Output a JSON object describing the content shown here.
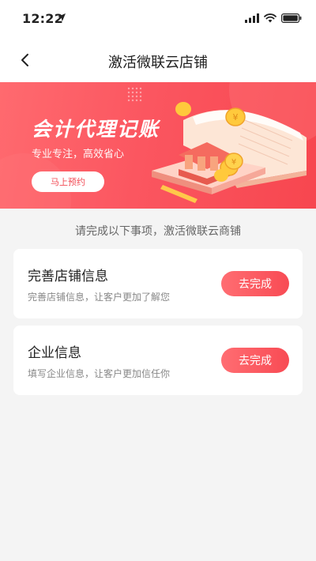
{
  "status_bar": {
    "time": "12:22",
    "icons": [
      "location-arrow-icon",
      "signal-icon",
      "wifi-icon",
      "battery-icon"
    ]
  },
  "nav": {
    "back_icon": "chevron-left-icon",
    "title": "激活微联云店铺"
  },
  "banner": {
    "title": "会计代理记账",
    "subtitle": "专业专注，高效省心",
    "button_label": "马上预约"
  },
  "notice": "请完成以下事项，激活微联云商铺",
  "tasks": [
    {
      "title": "完善店铺信息",
      "description": "完善店铺信息，让客户更加了解您",
      "button_label": "去完成"
    },
    {
      "title": "企业信息",
      "description": "填写企业信息，让客户更加信任你",
      "button_label": "去完成"
    }
  ],
  "colors": {
    "accent": "#f84b54",
    "banner_gradient_start": "#ff6a6f",
    "background": "#f4f4f4"
  }
}
